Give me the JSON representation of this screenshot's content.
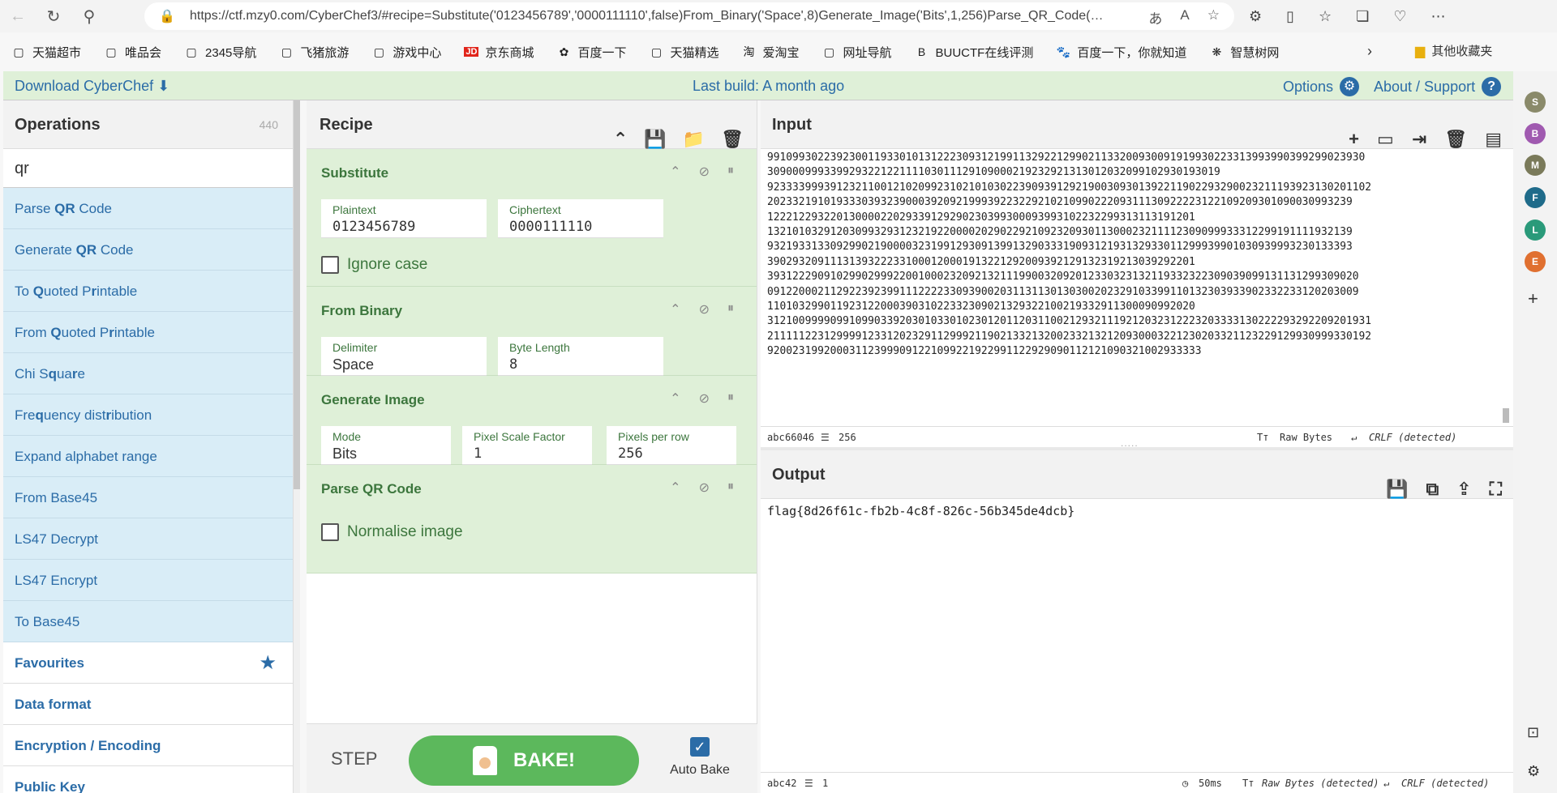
{
  "browser": {
    "url": "https://ctf.mzy0.com/CyberChef3/#recipe=Substitute('0123456789','0000111110',false)From_Binary('Space',8)Generate_Image('Bits',1,256)Parse_QR_Code(false)",
    "bookmarks": [
      {
        "label": "天猫超市",
        "icon": "page-icon"
      },
      {
        "label": "唯品会",
        "icon": "page-icon"
      },
      {
        "label": "2345导航",
        "icon": "page-icon"
      },
      {
        "label": "飞猪旅游",
        "icon": "page-icon"
      },
      {
        "label": "游戏中心",
        "icon": "page-icon"
      },
      {
        "label": "京东商城",
        "icon": "jd-icon"
      },
      {
        "label": "百度一下",
        "icon": "baidu-icon"
      },
      {
        "label": "天猫精选",
        "icon": "page-icon"
      },
      {
        "label": "爱淘宝",
        "icon": "taobao-icon"
      },
      {
        "label": "网址导航",
        "icon": "page-icon"
      },
      {
        "label": "BUUCTF在线评测",
        "icon": "buu-icon"
      },
      {
        "label": "百度一下，你就知道",
        "icon": "paw-icon"
      },
      {
        "label": "智慧树网",
        "icon": "tree-icon"
      }
    ],
    "other_bookmarks": "其他收藏夹",
    "edge_items": [
      {
        "letter": "S",
        "color": "#8a8a6a"
      },
      {
        "letter": "B",
        "color": "#a05ab0"
      },
      {
        "letter": "M",
        "color": "#7a7a5a"
      },
      {
        "letter": "F",
        "color": "#1f6b8a"
      },
      {
        "letter": "L",
        "color": "#2a9a7a"
      },
      {
        "letter": "E",
        "color": "#e07030"
      }
    ]
  },
  "topbar": {
    "download": "Download CyberChef",
    "build": "Last build: A month ago",
    "options": "Options",
    "about": "About / Support"
  },
  "operations": {
    "title": "Operations",
    "count": "440",
    "search": "qr",
    "results": [
      {
        "pre": "Parse ",
        "hl": "QR",
        "post": " Code"
      },
      {
        "pre": "Generate ",
        "hl": "QR",
        "post": " Code"
      },
      {
        "pre": "To ",
        "hl": "Q",
        "post": "uoted P",
        "hl2": "r",
        "post2": "intable"
      },
      {
        "pre": "From ",
        "hl": "Q",
        "post": "uoted P",
        "hl2": "r",
        "post2": "intable"
      },
      {
        "pre": "Chi S",
        "hl": "q",
        "post": "ua",
        "hl2": "r",
        "post2": "e"
      },
      {
        "pre": "Fre",
        "hl": "q",
        "post": "uency dist",
        "hl2": "r",
        "post2": "ibution"
      },
      {
        "pre": "Expand alphabet range",
        "hl": "",
        "post": ""
      },
      {
        "pre": "From Base45",
        "hl": "",
        "post": ""
      },
      {
        "pre": "LS47 Decrypt",
        "hl": "",
        "post": ""
      },
      {
        "pre": "LS47 Encrypt",
        "hl": "",
        "post": ""
      },
      {
        "pre": "To Base45",
        "hl": "",
        "post": ""
      }
    ],
    "categories": [
      "Favourites",
      "Data format",
      "Encryption / Encoding",
      "Public Key"
    ]
  },
  "recipe": {
    "title": "Recipe",
    "substitute": {
      "title": "Substitute",
      "plaintext_label": "Plaintext",
      "plaintext": "0123456789",
      "ciphertext_label": "Ciphertext",
      "ciphertext": "0000111110",
      "ignore_case": "Ignore case"
    },
    "from_binary": {
      "title": "From Binary",
      "delimiter_label": "Delimiter",
      "delimiter": "Space",
      "byte_length_label": "Byte Length",
      "byte_length": "8"
    },
    "generate_image": {
      "title": "Generate Image",
      "mode_label": "Mode",
      "mode": "Bits",
      "scale_label": "Pixel Scale Factor",
      "scale": "1",
      "ppr_label": "Pixels per row",
      "ppr": "256"
    },
    "parse_qr": {
      "title": "Parse QR Code",
      "normalise": "Normalise image"
    },
    "step": "STEP",
    "bake": "BAKE!",
    "auto_bake": "Auto Bake"
  },
  "input": {
    "title": "Input",
    "lines": [
      "99109930223923001193301013122230931219911329221299021133200930091919930223313993990399299023930",
      "309000999339929322122111103011129109000219232921313012032099102930193019",
      "923333999391232110012102099231021010302239093912921900309301392211902293290023211193923130201102",
      "202332191019333039323900039209219993922322921021099022209311130922223122109209301090030993239",
      "12221229322013000022029339129290230399300093993102232299313113191201",
      "132101032912030993293123219220000202902292109232093011300023211112309099933312299191111932139",
      "932193313309299021900003231991293091399132903331909312193132933011299939901030939993230133393",
      "39029320911131393222331000120001913221292009392129132319213039292201",
      "3931222909102990299922001000232092132111990032092012330323132119332322309039099131131299309020",
      "0912200021129223923991112222330939002031131130130300202329103399110132303933902332233120203009",
      "11010329901192312200039031022332309021329322100219332911300090992020",
      "312100999909910990339203010330102301201120311002129321119212032312223203333130222293292209201931",
      "211111223129999123312023291129992119021332132002332132120930003221230203321123229129930999330192",
      "920023199200031123999091221099221922991122929090112121090321002933333"
    ],
    "length": "66046",
    "lines_count": "256",
    "charenc": "Raw Bytes",
    "eol": "CRLF (detected)"
  },
  "output": {
    "title": "Output",
    "text": "flag{8d26f61c-fb2b-4c8f-826c-56b345de4dcb}",
    "length": "42",
    "lines_count": "1",
    "time": "50ms",
    "charenc": "Raw Bytes (detected)",
    "eol": "CRLF (detected)"
  }
}
